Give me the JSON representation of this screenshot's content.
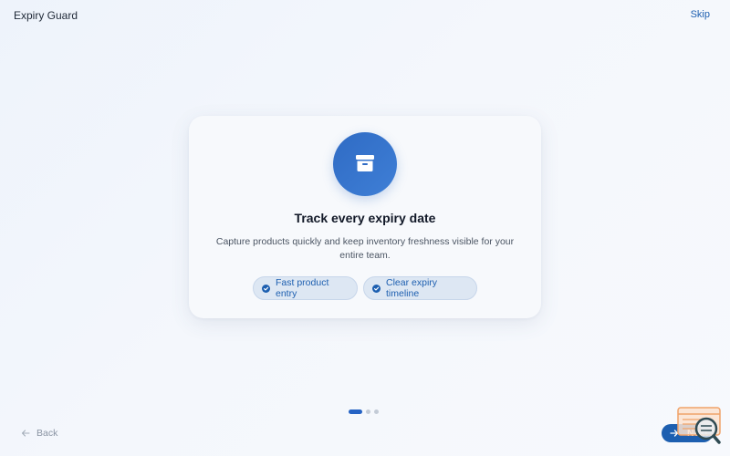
{
  "app": {
    "title": "Expiry Guard"
  },
  "header": {
    "skip_label": "Skip"
  },
  "onboarding": {
    "icon": "archive-box-icon",
    "title": "Track every expiry date",
    "description": "Capture products quickly and keep inventory freshness visible for your entire team.",
    "features": [
      {
        "label": "Fast product entry",
        "icon": "check-circle-icon"
      },
      {
        "label": "Clear expiry timeline",
        "icon": "check-circle-icon"
      }
    ],
    "step": {
      "current": 1,
      "total": 3
    }
  },
  "footer": {
    "back_label": "Back",
    "next_label": "Next"
  },
  "colors": {
    "accent": "#1d5fb0",
    "hero": "#2f6bc4",
    "chip_bg": "#dde7f3",
    "background": "#eef3fb"
  }
}
